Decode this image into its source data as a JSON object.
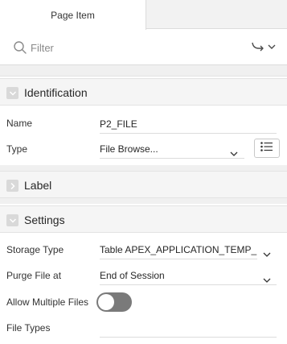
{
  "tabs": {
    "active_label": "Page Item"
  },
  "filter": {
    "placeholder": "Filter"
  },
  "icons": {
    "search": "search-icon",
    "goto": "go-to-group-icon",
    "list": "list-icon",
    "expand": "chevron-down-icon",
    "collapsed": "chevron-right-icon"
  },
  "sections": {
    "identification": {
      "title": "Identification",
      "expanded": true,
      "name_label": "Name",
      "name_value": "P2_FILE",
      "type_label": "Type",
      "type_value": "File Browse..."
    },
    "label": {
      "title": "Label",
      "expanded": false
    },
    "settings": {
      "title": "Settings",
      "expanded": true,
      "storage_type_label": "Storage Type",
      "storage_type_value": "Table APEX_APPLICATION_TEMP_FILES",
      "purge_label": "Purge File at",
      "purge_value": "End of Session",
      "allow_multiple_label": "Allow Multiple Files",
      "allow_multiple_on": false,
      "file_types_label": "File Types",
      "file_types_value": ""
    }
  },
  "colors": {
    "toggle_off": "#7a7a7a",
    "header_bg": "#f5f5f5"
  }
}
